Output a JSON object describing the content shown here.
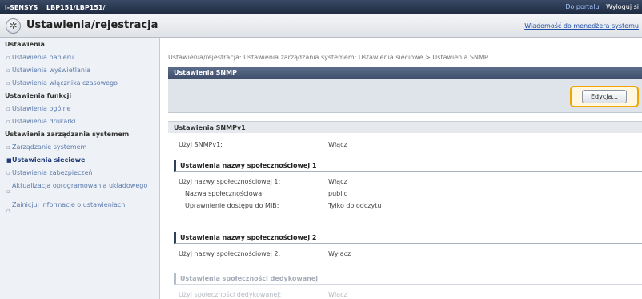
{
  "topbar": {
    "brand": "i-SENSYS",
    "model": "LBP151/LBP151/",
    "portal_link": "Do portalu",
    "logout": "Wyloguj si"
  },
  "header": {
    "title": "Ustawienia/rejestracja",
    "message_link": "Wiadomość do menedżera systemu"
  },
  "sidebar": {
    "settings_heading": "Ustawienia",
    "settings_items": [
      "Ustawienia papieru",
      "Ustawienia wyświetlania",
      "Ustawienia włącznika czasowego"
    ],
    "function_heading": "Ustawienia funkcji",
    "function_items": [
      "Ustawienia ogólne",
      "Ustawienia drukarki"
    ],
    "management_heading": "Ustawienia zarządzania systemem",
    "management_items": [
      "Zarządzanie systemem",
      "Ustawienia sieciowe",
      "Ustawienia zabezpieczeń",
      "Aktualizacja oprogramowania układowego",
      "Zainicjuj informacje o ustawieniach"
    ]
  },
  "main": {
    "breadcrumb": "Ustawienia/rejestracja: Ustawienia zarządzania systemem: Ustawienia sieciowe > Ustawienia SNMP",
    "panel_title": "Ustawienia SNMP",
    "edit_button": "Edycja...",
    "snmpv1_title": "Ustawienia SNMPv1",
    "use_snmpv1_label": "Użyj SNMPv1:",
    "use_snmpv1_value": "Włącz",
    "community1_title": "Ustawienia nazwy społecznościowej 1",
    "use_community1_label": "Użyj nazwy społecznościowej 1:",
    "use_community1_value": "Włącz",
    "community_name_label": "Nazwa społecznościowa:",
    "community_name_value": "public",
    "mib_access_label": "Uprawnienie dostępu do MIB:",
    "mib_access_value": "Tylko do odczytu",
    "community2_title": "Ustawienia nazwy społecznościowej 2",
    "use_community2_label": "Użyj nazwy społecznościowej 2:",
    "use_community2_value": "Wyłącz",
    "dedicated_title": "Ustawienia społeczności dedykowanej",
    "use_dedicated_label": "Użyj społeczności dedykowanej:",
    "use_dedicated_value": "Włącz"
  }
}
